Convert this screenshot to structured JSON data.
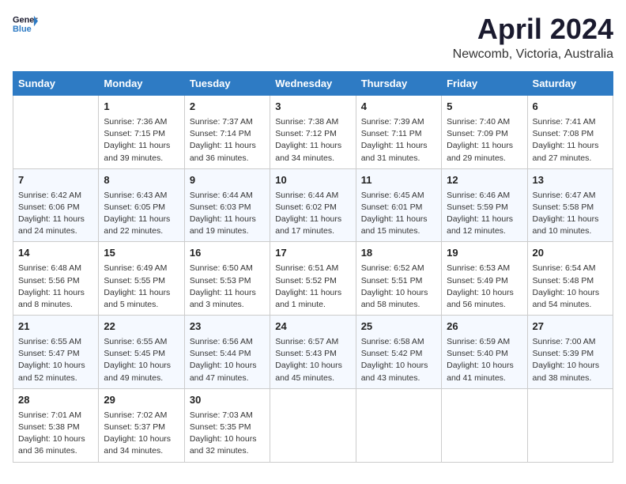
{
  "header": {
    "logo_line1": "General",
    "logo_line2": "Blue",
    "title": "April 2024",
    "location": "Newcomb, Victoria, Australia"
  },
  "calendar": {
    "days_of_week": [
      "Sunday",
      "Monday",
      "Tuesday",
      "Wednesday",
      "Thursday",
      "Friday",
      "Saturday"
    ],
    "weeks": [
      [
        {
          "day": "",
          "content": ""
        },
        {
          "day": "1",
          "content": "Sunrise: 7:36 AM\nSunset: 7:15 PM\nDaylight: 11 hours and 39 minutes."
        },
        {
          "day": "2",
          "content": "Sunrise: 7:37 AM\nSunset: 7:14 PM\nDaylight: 11 hours and 36 minutes."
        },
        {
          "day": "3",
          "content": "Sunrise: 7:38 AM\nSunset: 7:12 PM\nDaylight: 11 hours and 34 minutes."
        },
        {
          "day": "4",
          "content": "Sunrise: 7:39 AM\nSunset: 7:11 PM\nDaylight: 11 hours and 31 minutes."
        },
        {
          "day": "5",
          "content": "Sunrise: 7:40 AM\nSunset: 7:09 PM\nDaylight: 11 hours and 29 minutes."
        },
        {
          "day": "6",
          "content": "Sunrise: 7:41 AM\nSunset: 7:08 PM\nDaylight: 11 hours and 27 minutes."
        }
      ],
      [
        {
          "day": "7",
          "content": "Sunrise: 6:42 AM\nSunset: 6:06 PM\nDaylight: 11 hours and 24 minutes."
        },
        {
          "day": "8",
          "content": "Sunrise: 6:43 AM\nSunset: 6:05 PM\nDaylight: 11 hours and 22 minutes."
        },
        {
          "day": "9",
          "content": "Sunrise: 6:44 AM\nSunset: 6:03 PM\nDaylight: 11 hours and 19 minutes."
        },
        {
          "day": "10",
          "content": "Sunrise: 6:44 AM\nSunset: 6:02 PM\nDaylight: 11 hours and 17 minutes."
        },
        {
          "day": "11",
          "content": "Sunrise: 6:45 AM\nSunset: 6:01 PM\nDaylight: 11 hours and 15 minutes."
        },
        {
          "day": "12",
          "content": "Sunrise: 6:46 AM\nSunset: 5:59 PM\nDaylight: 11 hours and 12 minutes."
        },
        {
          "day": "13",
          "content": "Sunrise: 6:47 AM\nSunset: 5:58 PM\nDaylight: 11 hours and 10 minutes."
        }
      ],
      [
        {
          "day": "14",
          "content": "Sunrise: 6:48 AM\nSunset: 5:56 PM\nDaylight: 11 hours and 8 minutes."
        },
        {
          "day": "15",
          "content": "Sunrise: 6:49 AM\nSunset: 5:55 PM\nDaylight: 11 hours and 5 minutes."
        },
        {
          "day": "16",
          "content": "Sunrise: 6:50 AM\nSunset: 5:53 PM\nDaylight: 11 hours and 3 minutes."
        },
        {
          "day": "17",
          "content": "Sunrise: 6:51 AM\nSunset: 5:52 PM\nDaylight: 11 hours and 1 minute."
        },
        {
          "day": "18",
          "content": "Sunrise: 6:52 AM\nSunset: 5:51 PM\nDaylight: 10 hours and 58 minutes."
        },
        {
          "day": "19",
          "content": "Sunrise: 6:53 AM\nSunset: 5:49 PM\nDaylight: 10 hours and 56 minutes."
        },
        {
          "day": "20",
          "content": "Sunrise: 6:54 AM\nSunset: 5:48 PM\nDaylight: 10 hours and 54 minutes."
        }
      ],
      [
        {
          "day": "21",
          "content": "Sunrise: 6:55 AM\nSunset: 5:47 PM\nDaylight: 10 hours and 52 minutes."
        },
        {
          "day": "22",
          "content": "Sunrise: 6:55 AM\nSunset: 5:45 PM\nDaylight: 10 hours and 49 minutes."
        },
        {
          "day": "23",
          "content": "Sunrise: 6:56 AM\nSunset: 5:44 PM\nDaylight: 10 hours and 47 minutes."
        },
        {
          "day": "24",
          "content": "Sunrise: 6:57 AM\nSunset: 5:43 PM\nDaylight: 10 hours and 45 minutes."
        },
        {
          "day": "25",
          "content": "Sunrise: 6:58 AM\nSunset: 5:42 PM\nDaylight: 10 hours and 43 minutes."
        },
        {
          "day": "26",
          "content": "Sunrise: 6:59 AM\nSunset: 5:40 PM\nDaylight: 10 hours and 41 minutes."
        },
        {
          "day": "27",
          "content": "Sunrise: 7:00 AM\nSunset: 5:39 PM\nDaylight: 10 hours and 38 minutes."
        }
      ],
      [
        {
          "day": "28",
          "content": "Sunrise: 7:01 AM\nSunset: 5:38 PM\nDaylight: 10 hours and 36 minutes."
        },
        {
          "day": "29",
          "content": "Sunrise: 7:02 AM\nSunset: 5:37 PM\nDaylight: 10 hours and 34 minutes."
        },
        {
          "day": "30",
          "content": "Sunrise: 7:03 AM\nSunset: 5:35 PM\nDaylight: 10 hours and 32 minutes."
        },
        {
          "day": "",
          "content": ""
        },
        {
          "day": "",
          "content": ""
        },
        {
          "day": "",
          "content": ""
        },
        {
          "day": "",
          "content": ""
        }
      ]
    ]
  }
}
